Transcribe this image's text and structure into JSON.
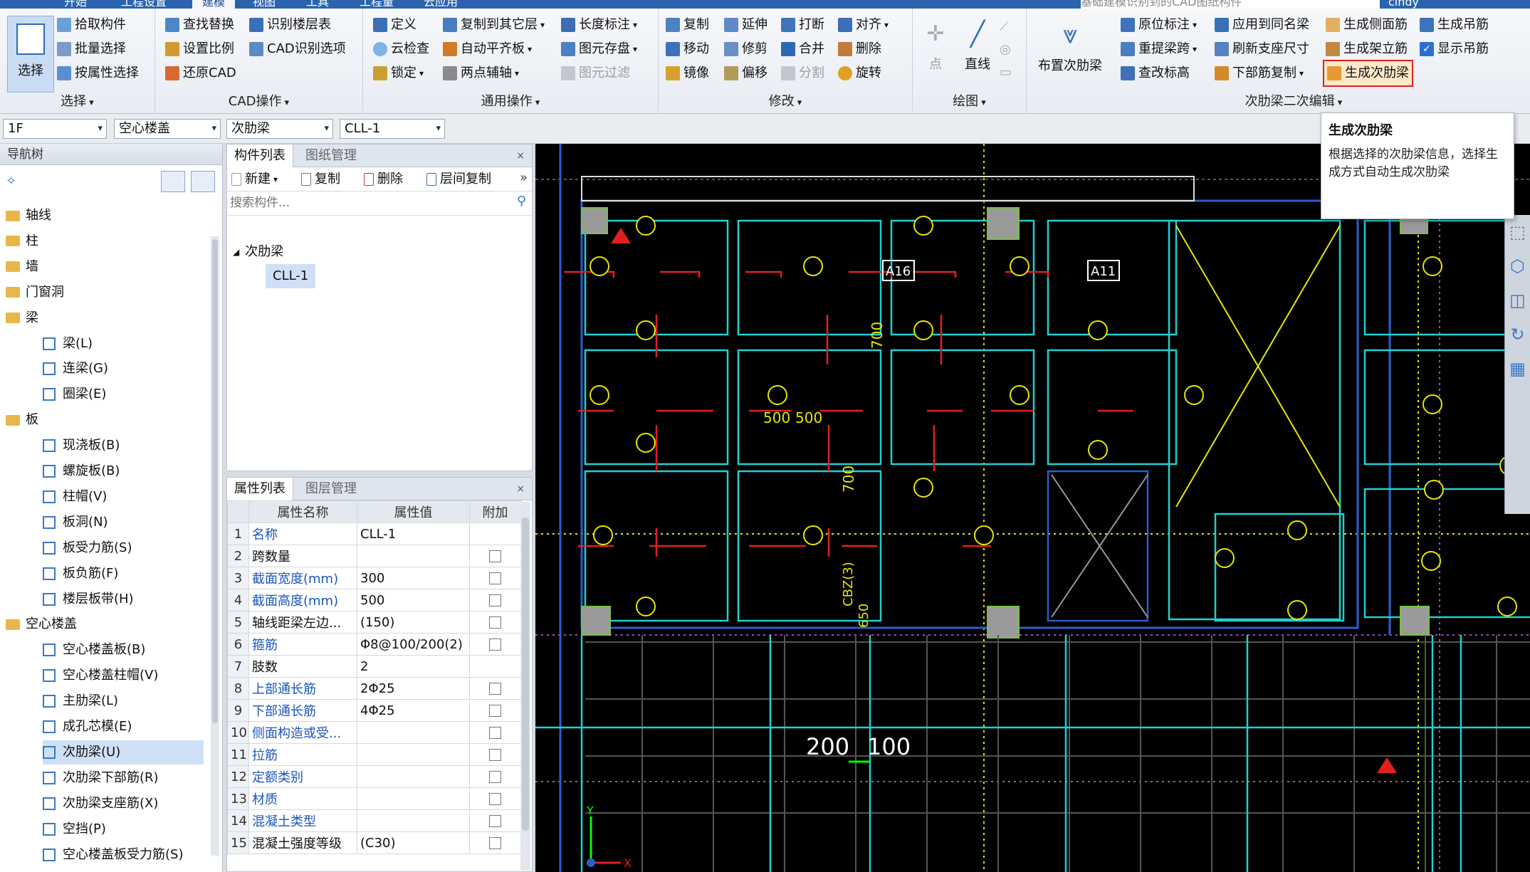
{
  "tabs": [
    "开始",
    "工程设置",
    "建模",
    "视图",
    "工具",
    "工程量",
    "云应用"
  ],
  "active_tab": "建模",
  "search_hint": "基础建模识别到的CAD图纸构件",
  "user": "cindy",
  "ribbon": {
    "select_group": {
      "label": "选择",
      "big_button": "选择",
      "items": [
        "拾取构件",
        "批量选择",
        "按属性选择"
      ]
    },
    "cad_group": {
      "label": "CAD操作",
      "items": [
        "查找替换",
        "设置比例",
        "还原CAD",
        "识别楼层表",
        "CAD识别选项"
      ]
    },
    "common_group": {
      "label": "通用操作",
      "items": [
        "定义",
        "云检查",
        "锁定",
        "复制到其它层",
        "自动平齐板",
        "两点辅轴",
        "长度标注",
        "图元存盘",
        "图元过滤"
      ]
    },
    "modify_group": {
      "label": "修改",
      "items": [
        "复制",
        "延伸",
        "打断",
        "对齐",
        "移动",
        "修剪",
        "合并",
        "删除",
        "镜像",
        "偏移",
        "分割",
        "旋转"
      ]
    },
    "draw_group": {
      "label": "绘图",
      "items": [
        "点",
        "直线"
      ]
    },
    "rib_group": {
      "label": "次肋梁二次编辑",
      "big_button": "布置次肋梁",
      "items": [
        "原位标注",
        "重提梁跨",
        "查改标高",
        "应用到同名梁",
        "刷新支座尺寸",
        "下部筋复制",
        "生成侧面筋",
        "生成架立筋",
        "生成次肋梁",
        "生成吊筋",
        "显示吊筋"
      ]
    }
  },
  "selectors": [
    "1F",
    "空心楼盖",
    "次肋梁",
    "CLL-1"
  ],
  "nav": {
    "title": "导航树",
    "items": [
      {
        "label": "轴线",
        "level": 0
      },
      {
        "label": "柱",
        "level": 0
      },
      {
        "label": "墙",
        "level": 0
      },
      {
        "label": "门窗洞",
        "level": 0
      },
      {
        "label": "梁",
        "level": 0
      },
      {
        "label": "梁(L)",
        "level": 1
      },
      {
        "label": "连梁(G)",
        "level": 1
      },
      {
        "label": "圈梁(E)",
        "level": 1
      },
      {
        "label": "板",
        "level": 0
      },
      {
        "label": "现浇板(B)",
        "level": 1
      },
      {
        "label": "螺旋板(B)",
        "level": 1
      },
      {
        "label": "柱帽(V)",
        "level": 1
      },
      {
        "label": "板洞(N)",
        "level": 1
      },
      {
        "label": "板受力筋(S)",
        "level": 1
      },
      {
        "label": "板负筋(F)",
        "level": 1
      },
      {
        "label": "楼层板带(H)",
        "level": 1
      },
      {
        "label": "空心楼盖",
        "level": 0
      },
      {
        "label": "空心楼盖板(B)",
        "level": 1
      },
      {
        "label": "空心楼盖柱帽(V)",
        "level": 1
      },
      {
        "label": "主肋梁(L)",
        "level": 1
      },
      {
        "label": "成孔芯模(E)",
        "level": 1
      },
      {
        "label": "次肋梁(U)",
        "level": 1
      },
      {
        "label": "次肋梁下部筋(R)",
        "level": 1
      },
      {
        "label": "次肋梁支座筋(X)",
        "level": 1
      },
      {
        "label": "空挡(P)",
        "level": 1
      },
      {
        "label": "空心楼盖板受力筋(S)",
        "level": 1
      }
    ]
  },
  "component_panel": {
    "tabs": [
      "构件列表",
      "图纸管理"
    ],
    "toolbar": [
      "新建",
      "复制",
      "删除",
      "层间复制"
    ],
    "search_placeholder": "搜索构件...",
    "tree_root": "次肋梁",
    "tree_child": "CLL-1"
  },
  "properties_panel": {
    "tabs": [
      "属性列表",
      "图层管理"
    ],
    "headers": [
      "属性名称",
      "属性值",
      "附加"
    ],
    "rows": [
      {
        "n": "1",
        "name": "名称",
        "value": "CLL-1",
        "blue": true,
        "chk": false
      },
      {
        "n": "2",
        "name": "跨数量",
        "value": "",
        "blue": false,
        "chk": true
      },
      {
        "n": "3",
        "name": "截面宽度(mm)",
        "value": "300",
        "blue": true,
        "chk": true
      },
      {
        "n": "4",
        "name": "截面高度(mm)",
        "value": "500",
        "blue": true,
        "chk": true
      },
      {
        "n": "5",
        "name": "轴线距梁左边...",
        "value": "(150)",
        "blue": false,
        "chk": true
      },
      {
        "n": "6",
        "name": "箍筋",
        "value": "Φ8@100/200(2)",
        "blue": true,
        "chk": true
      },
      {
        "n": "7",
        "name": "肢数",
        "value": "2",
        "blue": false,
        "chk": false
      },
      {
        "n": "8",
        "name": "上部通长筋",
        "value": "2Φ25",
        "blue": true,
        "chk": true
      },
      {
        "n": "9",
        "name": "下部通长筋",
        "value": "4Φ25",
        "blue": true,
        "chk": true
      },
      {
        "n": "10",
        "name": "侧面构造或受...",
        "value": "",
        "blue": true,
        "chk": true
      },
      {
        "n": "11",
        "name": "拉筋",
        "value": "",
        "blue": true,
        "chk": true
      },
      {
        "n": "12",
        "name": "定额类别",
        "value": "",
        "blue": true,
        "chk": true
      },
      {
        "n": "13",
        "name": "材质",
        "value": "",
        "blue": true,
        "chk": true
      },
      {
        "n": "14",
        "name": "混凝土类型",
        "value": "",
        "blue": true,
        "chk": true
      },
      {
        "n": "15",
        "name": "混凝土强度等级",
        "value": "(C30)",
        "blue": false,
        "chk": true
      }
    ]
  },
  "tooltip": {
    "title": "生成次肋梁",
    "body": "根据选择的次肋梁信息，选择生成方式自动生成次肋梁"
  },
  "cad_labels": {
    "dim_left": "200",
    "dim_right": "100",
    "a16": "A16",
    "a11": "A11",
    "v500a": "500",
    "v500b": "500",
    "v700a": "700",
    "v700b": "700",
    "v650": "650",
    "cbz": "CBZ(3)",
    "x_axis": "X",
    "y_axis": "Y"
  },
  "colors": {
    "beam_cyan": "#1fd1d1",
    "wall_blue": "#2a5fd0",
    "annot_yellow": "#e6e600",
    "rebar_red": "#e02020",
    "column_gray": "#9a9a9a",
    "highlight_red": "#e02020"
  }
}
